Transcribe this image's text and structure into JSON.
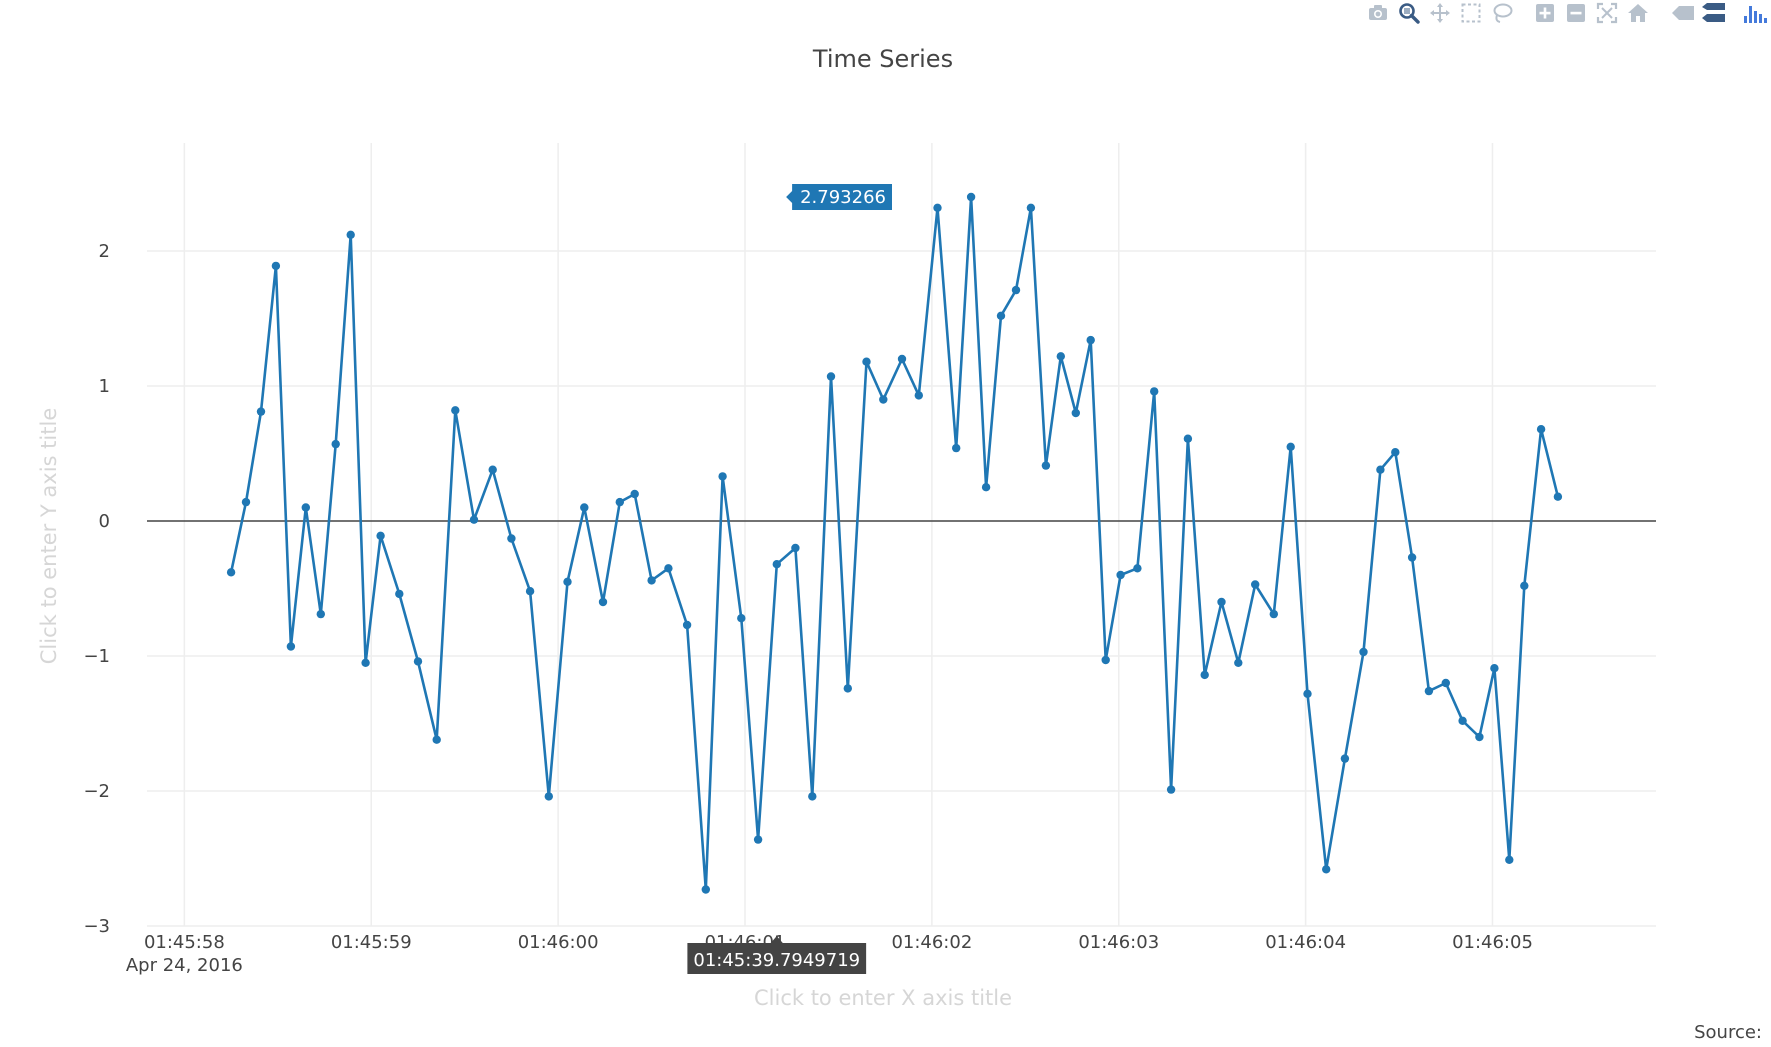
{
  "modebar": {
    "buttons": [
      {
        "icon": "camera-icon",
        "name": "download-plot-button"
      },
      {
        "icon": "zoom-icon",
        "name": "zoom-button"
      },
      {
        "icon": "pan-icon",
        "name": "pan-button"
      },
      {
        "icon": "box-select-icon",
        "name": "box-select-button"
      },
      {
        "icon": "lasso-icon",
        "name": "lasso-select-button"
      },
      {
        "icon": "zoom-in-icon",
        "name": "zoom-in-button"
      },
      {
        "icon": "zoom-out-icon",
        "name": "zoom-out-button"
      },
      {
        "icon": "autoscale-icon",
        "name": "autoscale-button"
      },
      {
        "icon": "home-icon",
        "name": "reset-axes-button"
      },
      {
        "icon": "spike-lines-icon",
        "name": "spike-lines-button"
      },
      {
        "icon": "compare-hover-icon",
        "name": "compare-hover-button"
      },
      {
        "icon": "plotly-logo-icon",
        "name": "plotly-logo-link"
      }
    ],
    "colors": {
      "default": "#b7c1cc",
      "active": "#3a5b84",
      "logo": "#447adb"
    }
  },
  "chart_data": {
    "type": "line",
    "title": "Time Series",
    "xlabel_placeholder": "Click to enter X axis title",
    "ylabel_placeholder": "Click to enter Y axis title",
    "source_label": "Source:",
    "mode": "lines+markers",
    "line_color": "#1f77b4",
    "grid": true,
    "zeroline": true,
    "x_range": [
      "2016-04-24 01:45:57.8",
      "2016-04-24 01:46:05.875"
    ],
    "y_range": [
      -3,
      2.8
    ],
    "x_ticks": [
      {
        "value": "2016-04-24 01:45:58",
        "label": "01:45:58",
        "sublabel": "Apr 24, 2016"
      },
      {
        "value": "2016-04-24 01:45:59",
        "label": "01:45:59"
      },
      {
        "value": "2016-04-24 01:46:00",
        "label": "01:46:00"
      },
      {
        "value": "2016-04-24 01:46:01",
        "label": "01:46:01"
      },
      {
        "value": "2016-04-24 01:46:02",
        "label": "01:46:02"
      },
      {
        "value": "2016-04-24 01:46:03",
        "label": "01:46:03"
      },
      {
        "value": "2016-04-24 01:46:04",
        "label": "01:46:04"
      },
      {
        "value": "2016-04-24 01:46:05",
        "label": "01:46:05"
      }
    ],
    "y_ticks": [
      {
        "value": 2,
        "label": "2"
      },
      {
        "value": 1,
        "label": "1"
      },
      {
        "value": 0,
        "label": "0"
      },
      {
        "value": -1,
        "label": "−1"
      },
      {
        "value": -2,
        "label": "−2"
      },
      {
        "value": -3,
        "label": "−3"
      }
    ],
    "hover": {
      "y_label": "2.793266",
      "y_label_x": "2016-04-24 01:46:01.22",
      "x_label": "01:45:39.7949719",
      "x_label_x": "2016-04-24 01:46:01.17"
    },
    "series": [
      {
        "x": [
          "2016-04-24 01:45:58.250",
          "2016-04-24 01:45:58.330",
          "2016-04-24 01:45:58.410",
          "2016-04-24 01:45:58.490",
          "2016-04-24 01:45:58.570",
          "2016-04-24 01:45:58.650",
          "2016-04-24 01:45:58.730",
          "2016-04-24 01:45:58.810",
          "2016-04-24 01:45:58.890",
          "2016-04-24 01:45:58.970",
          "2016-04-24 01:45:59.050",
          "2016-04-24 01:45:59.150",
          "2016-04-24 01:45:59.250",
          "2016-04-24 01:45:59.350",
          "2016-04-24 01:45:59.450",
          "2016-04-24 01:45:59.550",
          "2016-04-24 01:45:59.650",
          "2016-04-24 01:45:59.750",
          "2016-04-24 01:45:59.850",
          "2016-04-24 01:45:59.950",
          "2016-04-24 01:46:00.050",
          "2016-04-24 01:46:00.140",
          "2016-04-24 01:46:00.240",
          "2016-04-24 01:46:00.330",
          "2016-04-24 01:46:00.410",
          "2016-04-24 01:46:00.500",
          "2016-04-24 01:46:00.590",
          "2016-04-24 01:46:00.690",
          "2016-04-24 01:46:00.790",
          "2016-04-24 01:46:00.880",
          "2016-04-24 01:46:00.980",
          "2016-04-24 01:46:01.070",
          "2016-04-24 01:46:01.170",
          "2016-04-24 01:46:01.270",
          "2016-04-24 01:46:01.360",
          "2016-04-24 01:46:01.460",
          "2016-04-24 01:46:01.550",
          "2016-04-24 01:46:01.650",
          "2016-04-24 01:46:01.740",
          "2016-04-24 01:46:01.840",
          "2016-04-24 01:46:01.930",
          "2016-04-24 01:46:02.030",
          "2016-04-24 01:46:02.130",
          "2016-04-24 01:46:02.210",
          "2016-04-24 01:46:02.290",
          "2016-04-24 01:46:02.370",
          "2016-04-24 01:46:02.450",
          "2016-04-24 01:46:02.530",
          "2016-04-24 01:46:02.610",
          "2016-04-24 01:46:02.690",
          "2016-04-24 01:46:02.770",
          "2016-04-24 01:46:02.850",
          "2016-04-24 01:46:02.930",
          "2016-04-24 01:46:03.010",
          "2016-04-24 01:46:03.100",
          "2016-04-24 01:46:03.190",
          "2016-04-24 01:46:03.280",
          "2016-04-24 01:46:03.370",
          "2016-04-24 01:46:03.460",
          "2016-04-24 01:46:03.550",
          "2016-04-24 01:46:03.640",
          "2016-04-24 01:46:03.730",
          "2016-04-24 01:46:03.830",
          "2016-04-24 01:46:03.920",
          "2016-04-24 01:46:04.010",
          "2016-04-24 01:46:04.110",
          "2016-04-24 01:46:04.210",
          "2016-04-24 01:46:04.310",
          "2016-04-24 01:46:04.400",
          "2016-04-24 01:46:04.480",
          "2016-04-24 01:46:04.570",
          "2016-04-24 01:46:04.660",
          "2016-04-24 01:46:04.750",
          "2016-04-24 01:46:04.840",
          "2016-04-24 01:46:04.930",
          "2016-04-24 01:46:05.010",
          "2016-04-24 01:46:05.090",
          "2016-04-24 01:46:05.170",
          "2016-04-24 01:46:05.260",
          "2016-04-24 01:46:05.350"
        ],
        "y": [
          -0.38,
          0.14,
          0.81,
          1.89,
          -0.93,
          0.1,
          -0.69,
          0.57,
          2.12,
          -1.05,
          -0.11,
          -0.54,
          -1.04,
          -1.62,
          0.82,
          0.01,
          0.38,
          -0.13,
          -0.52,
          -2.04,
          -0.45,
          0.1,
          -0.6,
          0.14,
          0.2,
          -0.44,
          -0.35,
          -0.77,
          -2.73,
          0.33,
          -0.72,
          -2.36,
          -0.32,
          -0.2,
          -2.04,
          1.07,
          -1.24,
          1.18,
          0.9,
          1.2,
          0.93,
          2.32,
          0.54,
          2.4,
          0.25,
          1.52,
          1.71,
          2.32,
          0.41,
          1.22,
          0.8,
          1.34,
          -1.03,
          -0.4,
          -0.35,
          0.96,
          -1.99,
          0.61,
          -1.14,
          -0.6,
          -1.05,
          -0.47,
          -0.69,
          0.55,
          -1.28,
          -2.58,
          -1.76,
          -0.97,
          0.38,
          0.51,
          -0.27,
          -1.26,
          -1.2,
          -1.48,
          -1.6,
          -1.09,
          -2.51,
          -0.48,
          0.68,
          0.18
        ]
      }
    ]
  }
}
